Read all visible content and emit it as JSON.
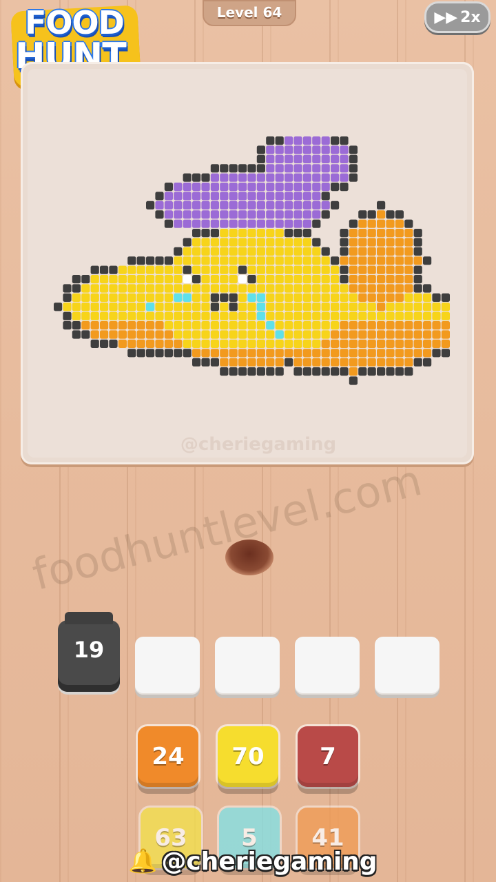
{
  "header": {
    "logo_line1": "FOOD",
    "logo_line2": "HUNT",
    "level_label": "Level 64",
    "speed_label": "2x"
  },
  "board": {
    "watermark": "@cheriegaming",
    "pixel_art_subject": "crying yellow banana with purple hat"
  },
  "site_watermark": "foodhuntlevel.com",
  "slots": {
    "jar_count": "19",
    "empty_slots": 4
  },
  "tiles_row1": [
    {
      "value": "24",
      "color": "#f08a2a"
    },
    {
      "value": "70",
      "color": "#f6dd2e"
    },
    {
      "value": "7",
      "color": "#b94a48"
    }
  ],
  "tiles_row2": [
    {
      "value": "63",
      "color": "#f3e24a"
    },
    {
      "value": "5",
      "color": "#7ee3ea"
    },
    {
      "value": "41",
      "color": "#f09a52"
    }
  ],
  "footer": {
    "handle": "@cheriegaming",
    "bell_icon": "bell-icon"
  },
  "colors": {
    "outline": "#3e3e3e",
    "yellow": "#f7d41a",
    "orange": "#f29a1e",
    "purple": "#9b6bd6",
    "cyan": "#5fe0ea",
    "white": "#ffffff"
  }
}
